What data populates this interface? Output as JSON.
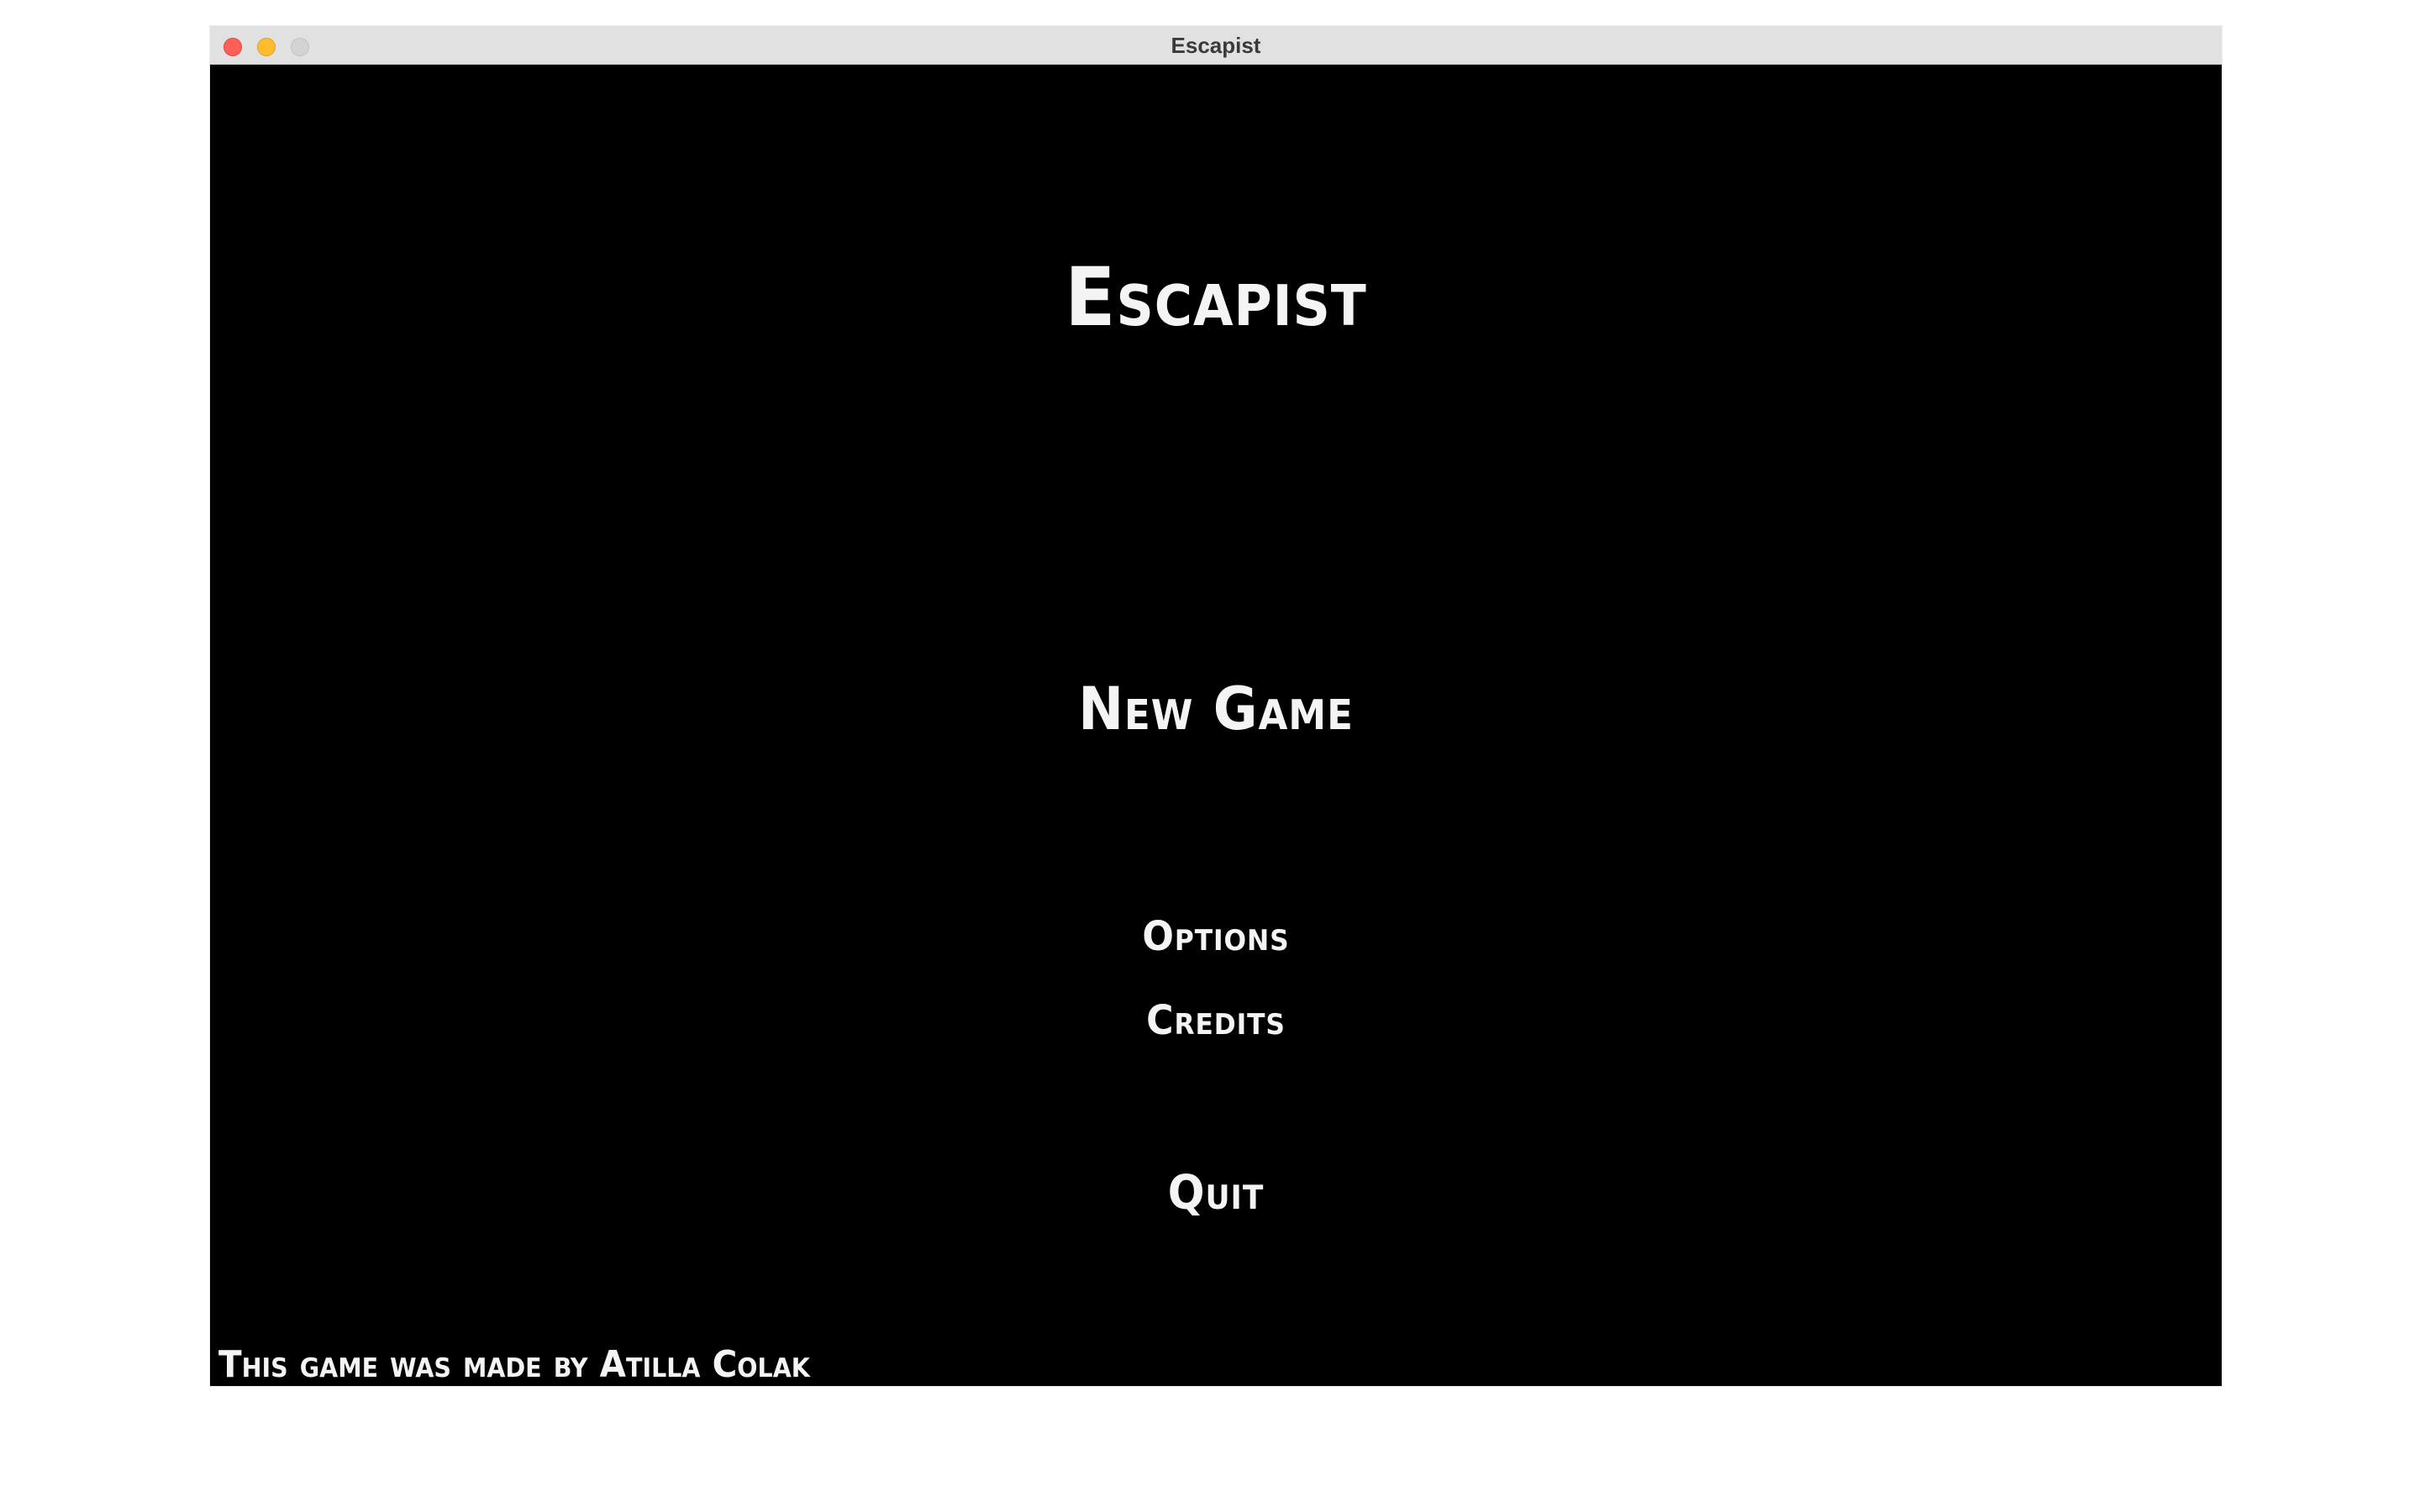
{
  "window": {
    "title": "Escapist",
    "controls": {
      "close_icon": "close-icon",
      "minimize_icon": "minimize-icon",
      "maximize_icon": "maximize-icon"
    }
  },
  "game": {
    "title": "Escapist",
    "menu": {
      "new_game": "New Game",
      "options": "Options",
      "credits": "Credits",
      "quit": "Quit"
    },
    "footer": "This game was made by Atilla Colak"
  },
  "colors": {
    "background": "#000000",
    "text": "#f4f4f4",
    "titlebar": "#e2e1e1",
    "close": "#fe5f57",
    "minimize": "#febc2e",
    "maximize": "#d3d3d3"
  }
}
